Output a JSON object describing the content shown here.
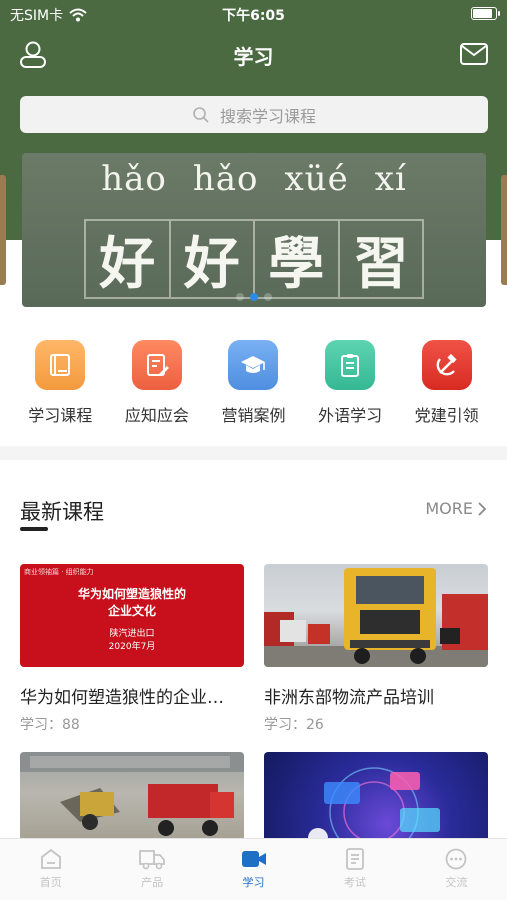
{
  "status_bar": {
    "carrier": "无SIM卡",
    "time": "下午6:05",
    "battery_level": 0.9
  },
  "nav": {
    "title": "学习",
    "user_icon": "user-icon",
    "mail_icon": "mail-icon"
  },
  "search": {
    "placeholder": "搜索学习课程",
    "icon": "search-icon"
  },
  "banner": {
    "pinyin": [
      "hǎo",
      "hǎo",
      "xüé",
      "xí"
    ],
    "characters": [
      "好",
      "好",
      "學",
      "習"
    ],
    "slide_count": 3,
    "active_slide": 2
  },
  "categories": [
    {
      "label": "学习课程",
      "icon": "book-icon",
      "color": "#f5a24b"
    },
    {
      "label": "应知应会",
      "icon": "edit-doc-icon",
      "color": "#f0704f"
    },
    {
      "label": "营销案例",
      "icon": "graduation-cap-icon",
      "color": "#5a9ae8"
    },
    {
      "label": "外语学习",
      "icon": "clipboard-icon",
      "color": "#43c3a2"
    },
    {
      "label": "党建引领",
      "icon": "hammer-sickle-icon",
      "color": "#e13a2f"
    }
  ],
  "latest": {
    "title": "最新课程",
    "more": "MORE",
    "courses": [
      {
        "title": "华为如何塑造狼性的企业…",
        "meta": "学习：88",
        "thumb_tag": "商业领袖篇 · 组织能力",
        "thumb_line1": "华为如何塑造狼性的",
        "thumb_line2": "企业文化",
        "thumb_line3": "陕汽进出口",
        "thumb_line4": "2020年7月"
      },
      {
        "title": "非洲东部物流产品培训",
        "meta": "学习：26"
      },
      {
        "title": "",
        "meta": ""
      },
      {
        "title": "",
        "meta": ""
      }
    ]
  },
  "tabbar": {
    "tabs": [
      {
        "label": "首页",
        "icon": "home-icon",
        "active": false
      },
      {
        "label": "产品",
        "icon": "truck-icon",
        "active": false
      },
      {
        "label": "学习",
        "icon": "video-icon",
        "active": true
      },
      {
        "label": "考试",
        "icon": "exam-doc-icon",
        "active": false
      },
      {
        "label": "交流",
        "icon": "chat-icon",
        "active": false
      }
    ]
  }
}
